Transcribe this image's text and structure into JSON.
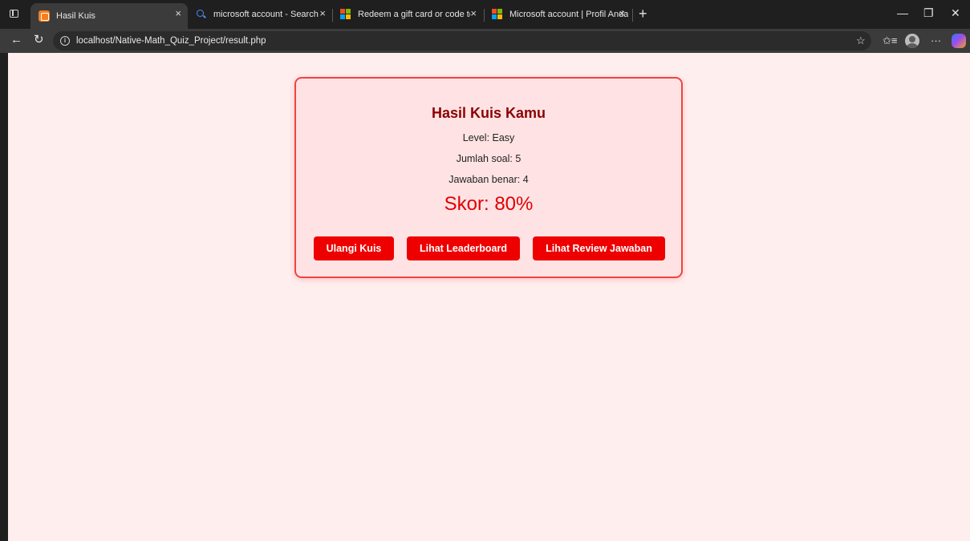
{
  "browser": {
    "tabs": [
      {
        "title": "Hasil Kuis",
        "icon": "xampp-icon",
        "active": true
      },
      {
        "title": "microsoft account - Search",
        "icon": "search-icon",
        "active": false
      },
      {
        "title": "Redeem a gift card or code to yo",
        "icon": "microsoft-icon",
        "active": false
      },
      {
        "title": "Microsoft account | Profil Anda",
        "icon": "microsoft-icon",
        "active": false
      }
    ],
    "tab_close": "×",
    "new_tab": "+",
    "window_controls": {
      "minimize": "—",
      "maximize": "❐",
      "close": "✕"
    },
    "nav": {
      "back": "←",
      "refresh": "↻"
    },
    "url": "localhost/Native-Math_Quiz_Project/result.php",
    "toolbar_icons": {
      "favorite": "☆",
      "collections": "✩≡",
      "more": "···"
    }
  },
  "result": {
    "title": "Hasil Kuis Kamu",
    "level": "Level: Easy",
    "question_count": "Jumlah soal: 5",
    "correct_answers": "Jawaban benar: 4",
    "score": "Skor: 80%",
    "buttons": {
      "retry": "Ulangi Kuis",
      "leaderboard": "Lihat Leaderboard",
      "review": "Lihat Review Jawaban"
    }
  },
  "colors": {
    "page_background": "#ffeeee",
    "card_background": "#ffe3e4",
    "card_border": "#ef4444",
    "title": "#8b0000",
    "score": "#e00000",
    "button": "#ee0000"
  }
}
